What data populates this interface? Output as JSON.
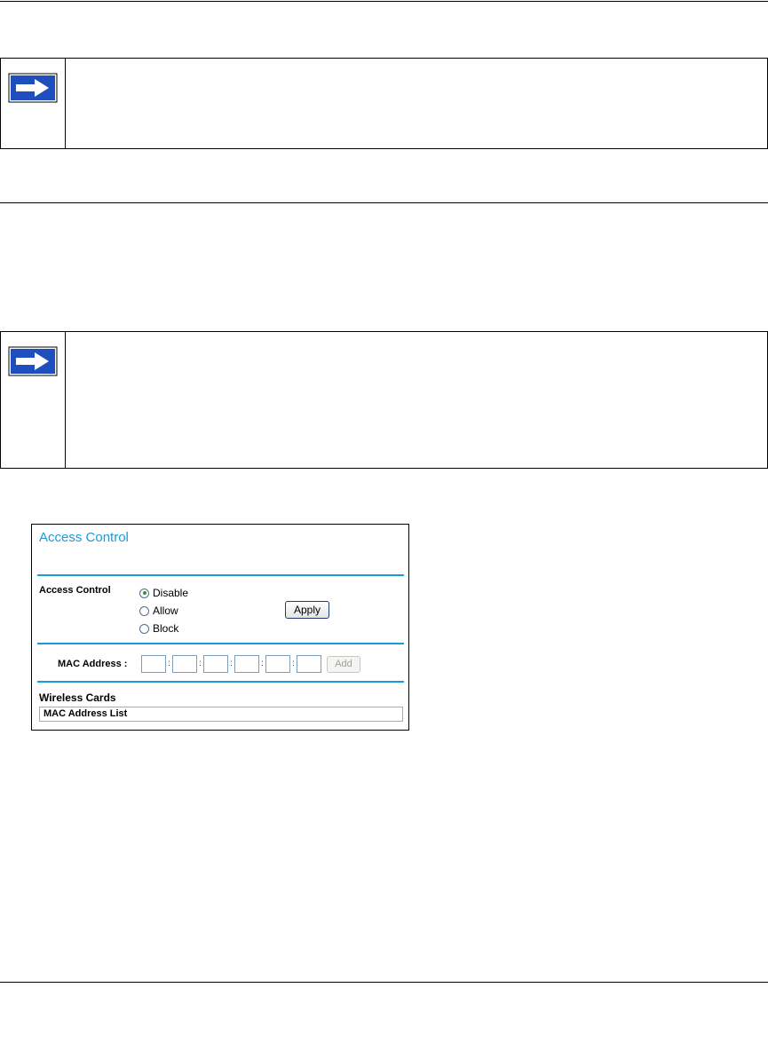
{
  "panel": {
    "title": "Access Control",
    "access_control_label": "Access Control",
    "options": [
      {
        "label": "Disable",
        "selected": true
      },
      {
        "label": "Allow",
        "selected": false
      },
      {
        "label": "Block",
        "selected": false
      }
    ],
    "apply_label": "Apply",
    "mac_address_label": "MAC Address :",
    "add_label": "Add",
    "wireless_cards_label": "Wireless Cards",
    "mac_list_header": "MAC Address List"
  },
  "colors": {
    "accent": "#1a9ad6",
    "note_arrow": "#1f4fbf"
  },
  "icons": {
    "note": "arrow-right-icon"
  }
}
